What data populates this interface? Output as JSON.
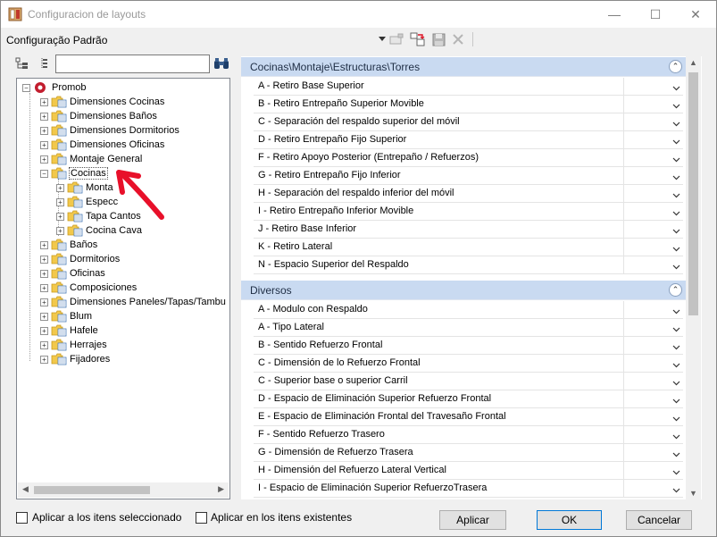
{
  "window": {
    "title": "Configuracion de layouts",
    "controls": {
      "minimize": "—",
      "maximize": "☐",
      "close": "✕"
    }
  },
  "toolbar": {
    "config_name": "Configuração Padrão",
    "icons": [
      "dropdown-arrow-icon",
      "sheet-icon",
      "copy-layout-icon",
      "save-icon",
      "delete-icon"
    ]
  },
  "left": {
    "search": {
      "value": "",
      "placeholder": ""
    },
    "tree": {
      "root": "Promob",
      "items": [
        "Dimensiones Cocinas",
        "Dimensiones Baños",
        "Dimensiones Dormitorios",
        "Dimensiones Oficinas",
        "Montaje General",
        "Cocinas",
        "Baños",
        "Dormitorios",
        "Oficinas",
        "Composiciones",
        "Dimensiones Paneles/Tapas/Tambu",
        "Blum",
        "Hafele",
        "Herrajes",
        "Fijadores"
      ],
      "cocinas_children": [
        "Monta",
        "Especc",
        "Tapa Cantos",
        "Cocina Cava"
      ]
    }
  },
  "right": {
    "sections": [
      {
        "title": "Cocinas\\Montaje\\Estructuras\\Torres",
        "rows": [
          "A - Retiro Base Superior",
          "B - Retiro Entrepaño Superior Movible",
          "C - Separación del respaldo superior del móvil",
          "D - Retiro Entrepaño Fijo Superior",
          "F - Retiro Apoyo Posterior (Entrepaño / Refuerzos)",
          "G - Retiro Entrepaño Fijo Inferior",
          "H - Separación del respaldo inferior del móvil",
          "I - Retiro Entrepaño Inferior Movible",
          "J - Retiro Base Inferior",
          "K - Retiro Lateral",
          "N - Espacio Superior del Respaldo"
        ]
      },
      {
        "title": "Diversos",
        "rows": [
          "A - Modulo con Respaldo",
          "A - Tipo Lateral",
          "B - Sentido Refuerzo Frontal",
          "C - Dimensión de lo Refuerzo Frontal",
          "C - Superior base o superior Carril",
          "D - Espacio de Eliminación Superior Refuerzo Frontal",
          "E - Espacio de Eliminación Frontal del Travesaño Frontal",
          "F - Sentido Refuerzo Trasero",
          "G - Dimensión de Refuerzo Trasera",
          "H - Dimensión del Refuerzo Lateral Vertical",
          "I - Espacio de Eliminación Superior RefuerzoTrasera"
        ]
      }
    ]
  },
  "bottom": {
    "checkbox1": "Aplicar a los itens seleccionado",
    "checkbox2": "Aplicar en los itens existentes",
    "apply": "Aplicar",
    "ok": "OK",
    "cancel": "Cancelar"
  },
  "colors": {
    "section_header": "#c9daf1",
    "annotation_arrow": "#e8102a"
  }
}
